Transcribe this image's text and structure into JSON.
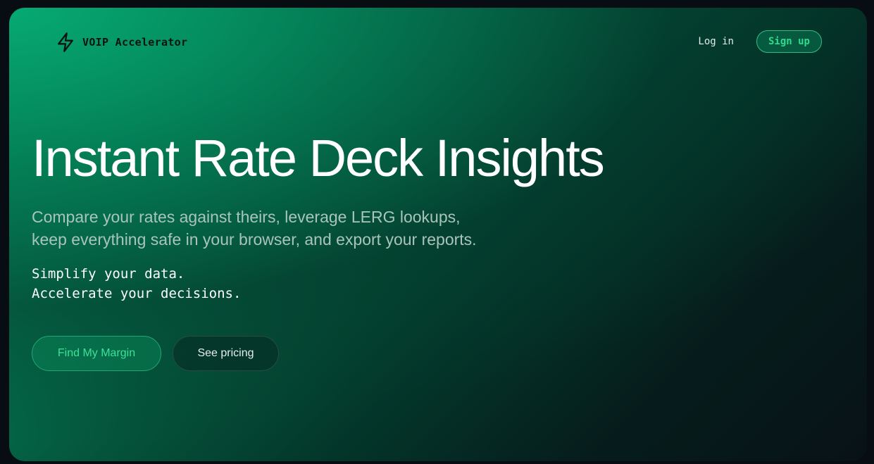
{
  "brand": {
    "name": "VOIP Accelerator",
    "icon": "lightning-bolt-icon"
  },
  "nav": {
    "login_label": "Log in",
    "signup_label": "Sign up"
  },
  "hero": {
    "title": "Instant Rate Deck Insights",
    "subtitle_lines": [
      "Compare your rates against theirs, leverage LERG lookups,",
      "keep everything safe in your browser, and export your reports."
    ],
    "tagline_lines": [
      "Simplify your data.",
      "Accelerate your decisions."
    ],
    "primary_cta": "Find My Margin",
    "secondary_cta": "See pricing"
  },
  "colors": {
    "accent": "#2fdb8f",
    "gradient_start": "#06a26c",
    "gradient_end": "#081216"
  }
}
